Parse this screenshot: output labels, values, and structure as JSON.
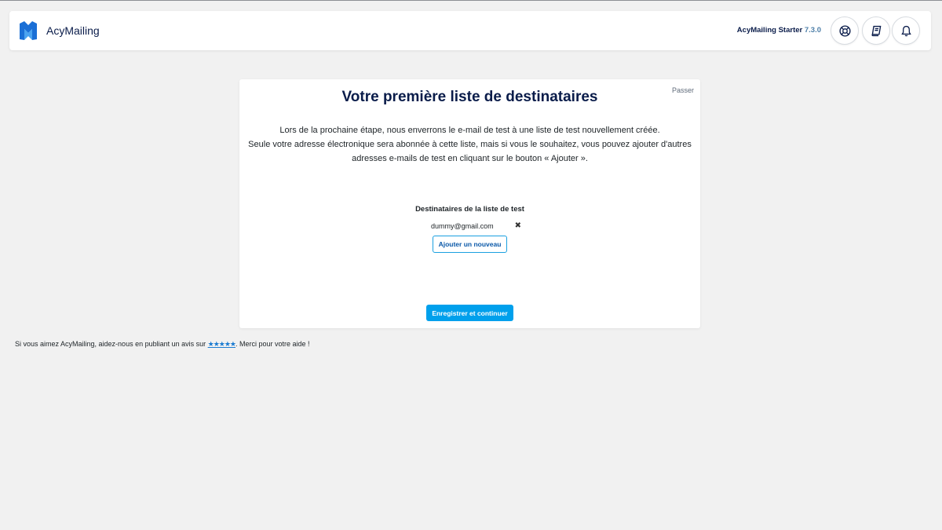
{
  "header": {
    "brand": "AcyMailing",
    "edition": "AcyMailing Starter",
    "version": "7.3.0",
    "icons": [
      "support-icon",
      "documentation-book-icon",
      "notification-bell-icon"
    ],
    "brand_color": "#1a6fd6"
  },
  "card": {
    "skip_label": "Passer",
    "title": "Votre première liste de destinataires",
    "description_lines": [
      "Lors de la prochaine étape, nous enverrons le e-mail de test à une liste de test nouvellement créée.",
      "Seule votre adresse électronique sera abonnée à cette liste, mais si vous le souhaitez, vous pouvez ajouter d'autres",
      "adresses e-mails de test en cliquant sur le bouton « Ajouter »."
    ],
    "list_title": "Destinataires de la liste de test",
    "recipients": [
      {
        "email": "dummy@gmail.com",
        "remove_symbol": "✖"
      }
    ],
    "add_label": "Ajouter un nouveau",
    "save_label": "Enregistrer et continuer",
    "accent_color": "#00a0ec"
  },
  "footer": {
    "text_before": "Si vous aimez AcyMailing, aidez-nous en publiant un avis sur ",
    "stars": "★★★★★",
    "text_after": ". Merci pour votre aide !"
  }
}
